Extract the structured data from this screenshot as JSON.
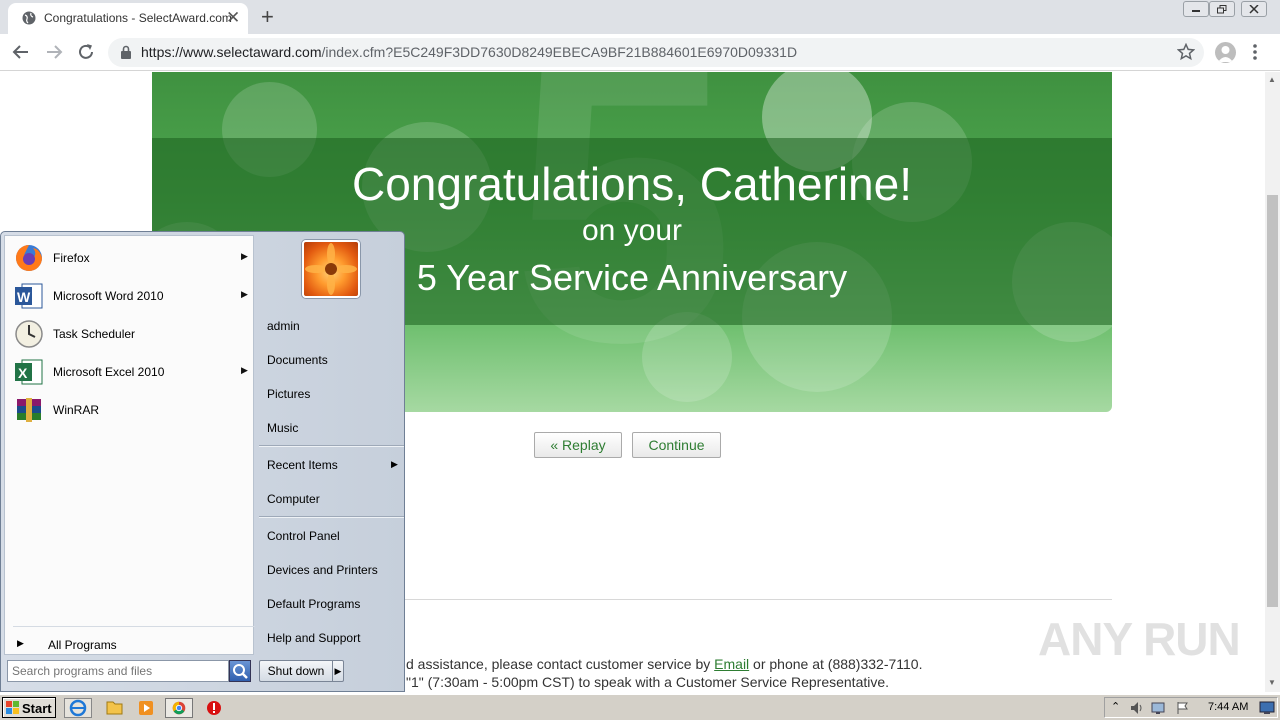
{
  "browser": {
    "tab_title": "Congratulations - SelectAward.com",
    "url_host": "https://www.selectaward.com",
    "url_path": "/index.cfm?E5C249F3DD7630D8249EBECA9BF21B884601E6970D09331D"
  },
  "banner": {
    "headline": "Congratulations, Catherine!",
    "subline": "on your",
    "anniversary": "5 Year Service Anniversary"
  },
  "buttons": {
    "replay": "« Replay",
    "continue": "Continue"
  },
  "footer": {
    "line1_before": "d assistance, please contact customer service by ",
    "email_link": "Email",
    "line1_after": " or phone at (888)332-7110.",
    "line2": "\"1\" (7:30am - 5:00pm CST) to speak with a Customer Service Representative."
  },
  "watermark": "ANY RUN",
  "start_menu": {
    "programs": [
      {
        "label": "Firefox",
        "icon": "firefox-icon",
        "has_submenu": true
      },
      {
        "label": "Microsoft Word 2010",
        "icon": "word-icon",
        "has_submenu": true
      },
      {
        "label": "Task Scheduler",
        "icon": "task-scheduler-icon",
        "has_submenu": false
      },
      {
        "label": "Microsoft Excel 2010",
        "icon": "excel-icon",
        "has_submenu": true
      },
      {
        "label": "WinRAR",
        "icon": "winrar-icon",
        "has_submenu": false
      }
    ],
    "all_programs": "All Programs",
    "search_placeholder": "Search programs and files",
    "right_items": [
      "admin",
      "Documents",
      "Pictures",
      "Music",
      "Recent Items",
      "Computer",
      "Control Panel",
      "Devices and Printers",
      "Default Programs",
      "Help and Support"
    ],
    "shutdown": "Shut down"
  },
  "taskbar": {
    "start": "Start",
    "clock": "7:44 AM"
  }
}
